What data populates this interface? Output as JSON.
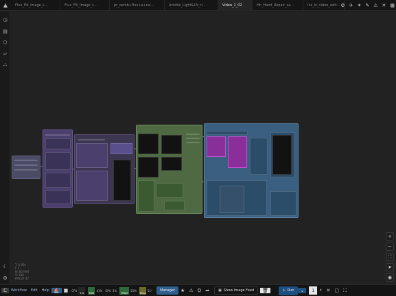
{
  "tabs": [
    {
      "label": "Flux_Fill_Image_L..."
    },
    {
      "label": "Flux_Fill_Image_L..."
    },
    {
      "label": "pr_oemb+flux+a+ne..."
    },
    {
      "label": "Artistic_Light&LN_ri..."
    },
    {
      "label": "Video_1_02"
    },
    {
      "label": "Hh_Hand_Repair_sa..."
    },
    {
      "label": "Ins_in_video_edit..."
    }
  ],
  "active_tab_index": 4,
  "stats": {
    "line1": "T: 0.00s",
    "line2": "I: 0",
    "line3": "N: 60 [60]",
    "line4": "V: 199",
    "line5": "FPS:27.47"
  },
  "bottom": {
    "workflow": "Workflow",
    "edit": "Edit",
    "help": "Help",
    "cpu_label": "CPU",
    "cpu_value": "1%",
    "ram_label": "RAM",
    "ram_value": "41%",
    "gpu_label": "GPU",
    "gpu_value": "3%",
    "vram_label": "VRAM",
    "vram_value": "55%",
    "temp_label": "Temp",
    "temp_value": "51°",
    "manager": "Manager",
    "show_image_feed": "Show Image Feed",
    "run": "Run",
    "queue_count": "1"
  },
  "colors": {
    "group_purple": "#4b3f6e",
    "group_green": "#4f6a43",
    "group_blue": "#3a5f80",
    "accent": "#2f5f8c",
    "cpu_bar": "#1e4f7a",
    "ram_bar": "#2f6b3a",
    "gpu_bar": "#1e4f7a",
    "vram_bar": "#2f6b3a",
    "temp_bar": "#6b6b2f"
  },
  "meters": {
    "cpu": 0.01,
    "ram": 0.41,
    "gpu": 0.03,
    "vram": 0.55,
    "temp": 0.51
  }
}
